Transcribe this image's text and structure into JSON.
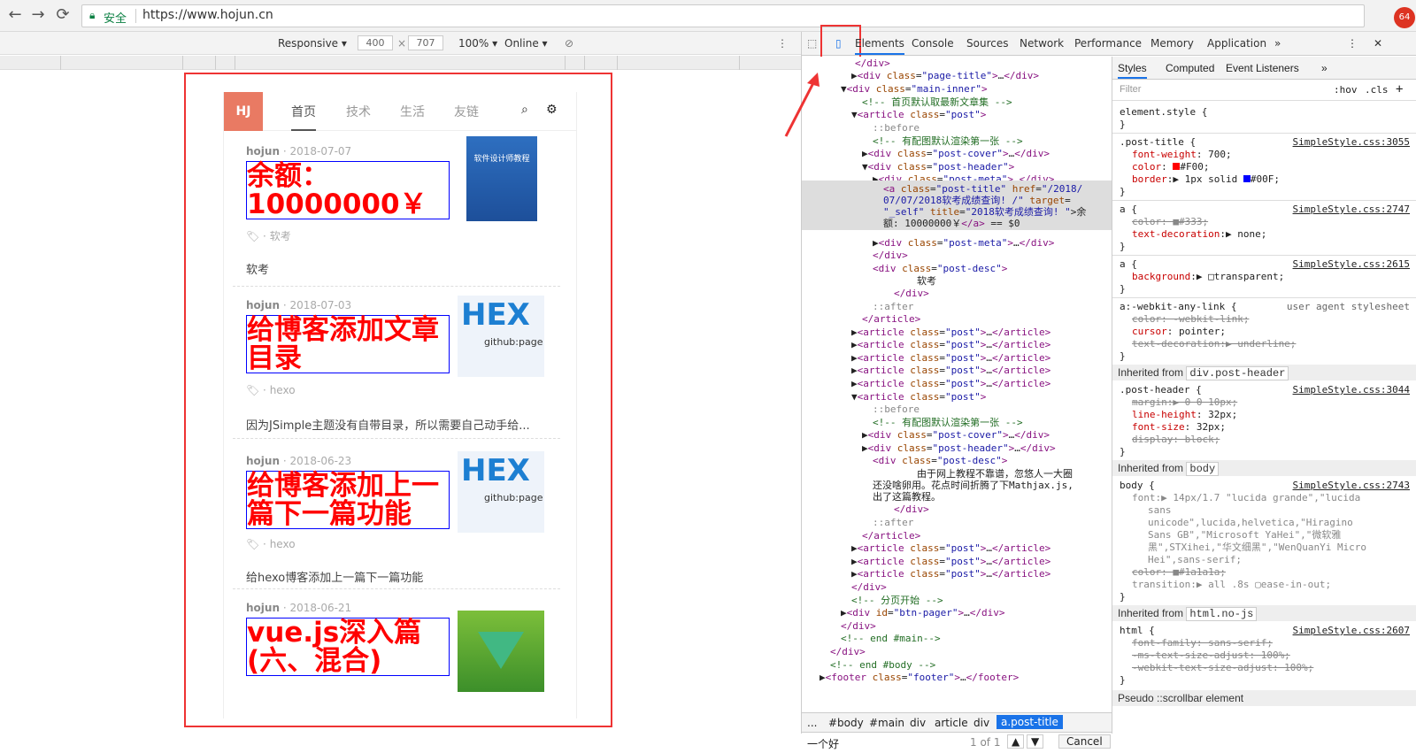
{
  "browser": {
    "secure_label": "安全",
    "url": "https://www.hojun.cn",
    "ext_badge": "64"
  },
  "device_toolbar": {
    "device": "Responsive",
    "width": "400",
    "height": "707",
    "zoom": "100%",
    "network": "Online"
  },
  "site": {
    "logo": "HJ",
    "nav": [
      "首页",
      "技术",
      "生活",
      "友链"
    ],
    "posts": [
      {
        "author": "hojun",
        "date": "· 2018-07-07",
        "title": "余额：10000000￥",
        "tag": "软考",
        "desc": "软考",
        "thumb_text": "软件设计师教程"
      },
      {
        "author": "hojun",
        "date": "· 2018-07-03",
        "title": "给博客添加文章目录",
        "tag": "hexo",
        "desc": "因为JSimple主题没有自带目录，所以需要自己动手给...",
        "thumb_text": "github:page"
      },
      {
        "author": "hojun",
        "date": "· 2018-06-23",
        "title": "给博客添加上一篇下一篇功能",
        "tag": "hexo",
        "desc": "给hexo博客添加上一篇下一篇功能",
        "thumb_text": "github:page"
      },
      {
        "author": "hojun",
        "date": "· 2018-06-21",
        "title": "vue.js深入篇(六、混合)",
        "tag": "",
        "desc": "",
        "thumb_text": ""
      }
    ]
  },
  "devtools": {
    "tabs": [
      "Elements",
      "Console",
      "Sources",
      "Network",
      "Performance",
      "Memory",
      "Application"
    ],
    "more": "»",
    "crumbs": [
      "...",
      "#body",
      "#main",
      "div",
      "article",
      "div",
      "a.post-title"
    ],
    "search_value": "一个好",
    "search_count": "1 of 1",
    "cancel": "Cancel",
    "styles_tabs": [
      "Styles",
      "Computed",
      "Event Listeners"
    ],
    "filter_placeholder": "Filter",
    "hov": ":hov",
    "cls": ".cls",
    "pseudo_label": "Pseudo ::scrollbar element"
  }
}
